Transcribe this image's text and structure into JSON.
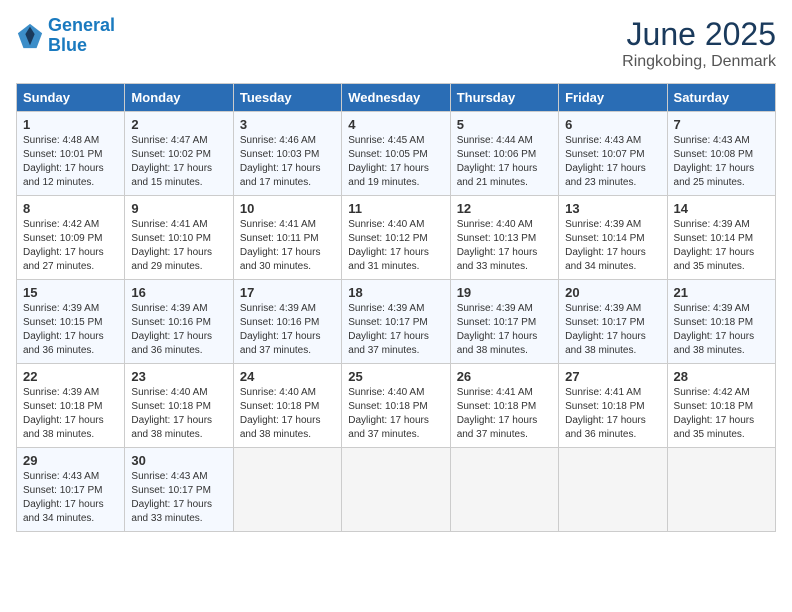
{
  "logo": {
    "line1": "General",
    "line2": "Blue"
  },
  "title": "June 2025",
  "subtitle": "Ringkobing, Denmark",
  "days_header": [
    "Sunday",
    "Monday",
    "Tuesday",
    "Wednesday",
    "Thursday",
    "Friday",
    "Saturday"
  ],
  "weeks": [
    [
      {
        "day": "1",
        "info": "Sunrise: 4:48 AM\nSunset: 10:01 PM\nDaylight: 17 hours\nand 12 minutes."
      },
      {
        "day": "2",
        "info": "Sunrise: 4:47 AM\nSunset: 10:02 PM\nDaylight: 17 hours\nand 15 minutes."
      },
      {
        "day": "3",
        "info": "Sunrise: 4:46 AM\nSunset: 10:03 PM\nDaylight: 17 hours\nand 17 minutes."
      },
      {
        "day": "4",
        "info": "Sunrise: 4:45 AM\nSunset: 10:05 PM\nDaylight: 17 hours\nand 19 minutes."
      },
      {
        "day": "5",
        "info": "Sunrise: 4:44 AM\nSunset: 10:06 PM\nDaylight: 17 hours\nand 21 minutes."
      },
      {
        "day": "6",
        "info": "Sunrise: 4:43 AM\nSunset: 10:07 PM\nDaylight: 17 hours\nand 23 minutes."
      },
      {
        "day": "7",
        "info": "Sunrise: 4:43 AM\nSunset: 10:08 PM\nDaylight: 17 hours\nand 25 minutes."
      }
    ],
    [
      {
        "day": "8",
        "info": "Sunrise: 4:42 AM\nSunset: 10:09 PM\nDaylight: 17 hours\nand 27 minutes."
      },
      {
        "day": "9",
        "info": "Sunrise: 4:41 AM\nSunset: 10:10 PM\nDaylight: 17 hours\nand 29 minutes."
      },
      {
        "day": "10",
        "info": "Sunrise: 4:41 AM\nSunset: 10:11 PM\nDaylight: 17 hours\nand 30 minutes."
      },
      {
        "day": "11",
        "info": "Sunrise: 4:40 AM\nSunset: 10:12 PM\nDaylight: 17 hours\nand 31 minutes."
      },
      {
        "day": "12",
        "info": "Sunrise: 4:40 AM\nSunset: 10:13 PM\nDaylight: 17 hours\nand 33 minutes."
      },
      {
        "day": "13",
        "info": "Sunrise: 4:39 AM\nSunset: 10:14 PM\nDaylight: 17 hours\nand 34 minutes."
      },
      {
        "day": "14",
        "info": "Sunrise: 4:39 AM\nSunset: 10:14 PM\nDaylight: 17 hours\nand 35 minutes."
      }
    ],
    [
      {
        "day": "15",
        "info": "Sunrise: 4:39 AM\nSunset: 10:15 PM\nDaylight: 17 hours\nand 36 minutes."
      },
      {
        "day": "16",
        "info": "Sunrise: 4:39 AM\nSunset: 10:16 PM\nDaylight: 17 hours\nand 36 minutes."
      },
      {
        "day": "17",
        "info": "Sunrise: 4:39 AM\nSunset: 10:16 PM\nDaylight: 17 hours\nand 37 minutes."
      },
      {
        "day": "18",
        "info": "Sunrise: 4:39 AM\nSunset: 10:17 PM\nDaylight: 17 hours\nand 37 minutes."
      },
      {
        "day": "19",
        "info": "Sunrise: 4:39 AM\nSunset: 10:17 PM\nDaylight: 17 hours\nand 38 minutes."
      },
      {
        "day": "20",
        "info": "Sunrise: 4:39 AM\nSunset: 10:17 PM\nDaylight: 17 hours\nand 38 minutes."
      },
      {
        "day": "21",
        "info": "Sunrise: 4:39 AM\nSunset: 10:18 PM\nDaylight: 17 hours\nand 38 minutes."
      }
    ],
    [
      {
        "day": "22",
        "info": "Sunrise: 4:39 AM\nSunset: 10:18 PM\nDaylight: 17 hours\nand 38 minutes."
      },
      {
        "day": "23",
        "info": "Sunrise: 4:40 AM\nSunset: 10:18 PM\nDaylight: 17 hours\nand 38 minutes."
      },
      {
        "day": "24",
        "info": "Sunrise: 4:40 AM\nSunset: 10:18 PM\nDaylight: 17 hours\nand 38 minutes."
      },
      {
        "day": "25",
        "info": "Sunrise: 4:40 AM\nSunset: 10:18 PM\nDaylight: 17 hours\nand 37 minutes."
      },
      {
        "day": "26",
        "info": "Sunrise: 4:41 AM\nSunset: 10:18 PM\nDaylight: 17 hours\nand 37 minutes."
      },
      {
        "day": "27",
        "info": "Sunrise: 4:41 AM\nSunset: 10:18 PM\nDaylight: 17 hours\nand 36 minutes."
      },
      {
        "day": "28",
        "info": "Sunrise: 4:42 AM\nSunset: 10:18 PM\nDaylight: 17 hours\nand 35 minutes."
      }
    ],
    [
      {
        "day": "29",
        "info": "Sunrise: 4:43 AM\nSunset: 10:17 PM\nDaylight: 17 hours\nand 34 minutes."
      },
      {
        "day": "30",
        "info": "Sunrise: 4:43 AM\nSunset: 10:17 PM\nDaylight: 17 hours\nand 33 minutes."
      },
      {
        "day": "",
        "info": ""
      },
      {
        "day": "",
        "info": ""
      },
      {
        "day": "",
        "info": ""
      },
      {
        "day": "",
        "info": ""
      },
      {
        "day": "",
        "info": ""
      }
    ]
  ]
}
